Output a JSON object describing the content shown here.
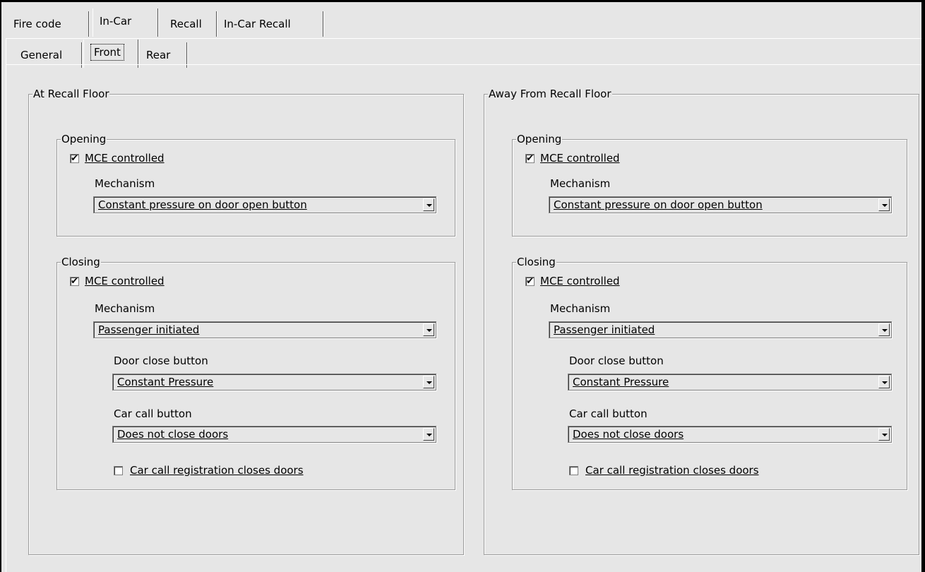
{
  "tabs_top": [
    "Fire code",
    "In-Car",
    "Recall",
    "In-Car Recall"
  ],
  "tabs_sub": [
    "General",
    "Front",
    "Rear"
  ],
  "panels": [
    {
      "title": "At Recall Floor",
      "opening": {
        "title": "Opening",
        "mce_label": "MCE controlled",
        "mce_checked": true,
        "mechanism_label": "Mechanism",
        "mechanism_value": "Constant pressure on door open button"
      },
      "closing": {
        "title": "Closing",
        "mce_label": "MCE controlled",
        "mce_checked": true,
        "mechanism_label": "Mechanism",
        "mechanism_value": "Passenger initiated",
        "door_close_label": "Door close button",
        "door_close_value": "Constant Pressure",
        "car_call_label": "Car call button",
        "car_call_value": "Does not close doors",
        "registration_label": "Car call registration closes doors",
        "registration_checked": false
      }
    },
    {
      "title": "Away From Recall Floor",
      "opening": {
        "title": "Opening",
        "mce_label": "MCE controlled",
        "mce_checked": true,
        "mechanism_label": "Mechanism",
        "mechanism_value": "Constant pressure on door open button"
      },
      "closing": {
        "title": "Closing",
        "mce_label": "MCE controlled",
        "mce_checked": true,
        "mechanism_label": "Mechanism",
        "mechanism_value": "Passenger initiated",
        "door_close_label": "Door close button",
        "door_close_value": "Constant Pressure",
        "car_call_label": "Car call button",
        "car_call_value": "Does not close doors",
        "registration_label": "Car call registration closes doors",
        "registration_checked": false
      }
    }
  ],
  "icons": {
    "checkmark": "✔",
    "dropdown": "chevron-down-icon"
  }
}
